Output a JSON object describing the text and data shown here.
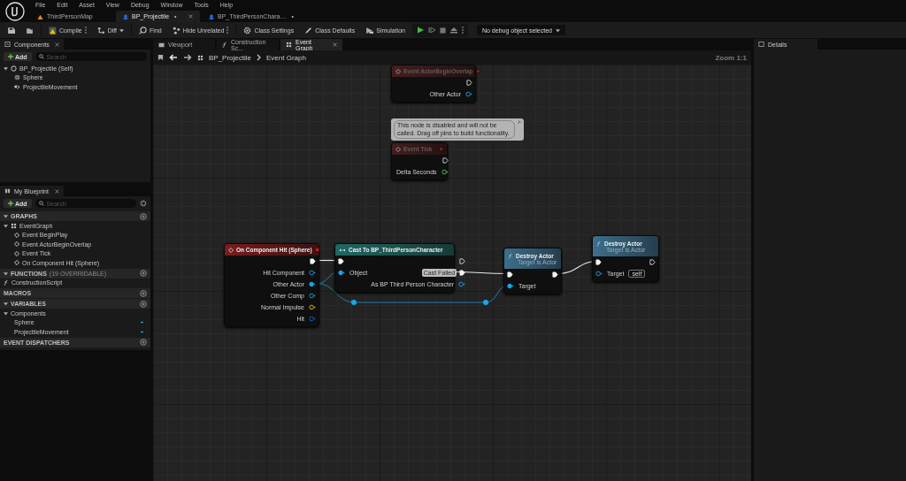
{
  "menu": [
    "File",
    "Edit",
    "Asset",
    "View",
    "Debug",
    "Window",
    "Tools",
    "Help"
  ],
  "document_tabs": [
    {
      "label": "ThirdPersonMap",
      "selected": false
    },
    {
      "label": "BP_Projectile",
      "selected": true,
      "mark": "•"
    },
    {
      "label": "BP_ThirdPersonChara…",
      "selected": false,
      "mark": "•"
    }
  ],
  "toolbar": [
    {
      "kind": "icon"
    },
    {
      "kind": "icon"
    },
    {
      "kind": "menu",
      "label": "Compile"
    },
    {
      "kind": "dropdown",
      "label": "Diff"
    },
    {
      "kind": "button",
      "label": "Find"
    },
    {
      "kind": "menu",
      "label": "Hide Unrelated"
    },
    {
      "kind": "button",
      "label": "Class Settings"
    },
    {
      "kind": "button",
      "label": "Class Defaults"
    },
    {
      "kind": "button",
      "label": "Simulation"
    }
  ],
  "debug_filter": {
    "value": "No debug object selected"
  },
  "components_panel": {
    "title": "Components",
    "add": "Add",
    "search": {
      "placeholder": "Search"
    },
    "tree": [
      {
        "label": "BP_Projectile (Self)",
        "children": [
          {
            "label": "Sphere"
          },
          {
            "label": "ProjectileMovement"
          }
        ]
      }
    ]
  },
  "blueprint_panel": {
    "title": "My Blueprint",
    "add": "Add",
    "search": {
      "placeholder": "Search"
    },
    "sections": [
      {
        "title": "GRAPHS",
        "expanded": true,
        "items": [
          {
            "label": "EventGraph",
            "children": [
              {
                "label": "Event BeginPlay"
              },
              {
                "label": "Event ActorBeginOverlap"
              },
              {
                "label": "Event Tick"
              },
              {
                "label": "On Component Hit (Sphere)"
              }
            ]
          }
        ]
      },
      {
        "title": "FUNCTIONS",
        "note": "(19 OVERRIDABLE)",
        "expanded": true,
        "items": [
          {
            "label": "ConstructionScript"
          }
        ]
      },
      {
        "title": "MACROS",
        "expanded": false
      },
      {
        "title": "VARIABLES",
        "expanded": true,
        "items": [
          {
            "label": "Components",
            "children": [
              {
                "label": "Sphere"
              },
              {
                "label": "ProjectileMovement"
              }
            ]
          }
        ]
      },
      {
        "title": "EVENT DISPATCHERS",
        "expanded": false
      }
    ]
  },
  "graph_tabs": [
    {
      "label": "Viewport",
      "selected": false
    },
    {
      "label": "Construction Sc...",
      "selected": false
    },
    {
      "label": "Event Graph",
      "selected": true
    }
  ],
  "breadcrumb": [
    "BP_Projectile",
    "Event Graph"
  ],
  "zoom": "Zoom 1:1",
  "nodes": [
    {
      "kind": "event",
      "title": "Event ActorBeginOverlap",
      "disabled": true,
      "outputs": [
        {
          "kind": "exec",
          "connected": false
        },
        {
          "kind": "object",
          "label": "Other Actor",
          "connected": false
        }
      ]
    },
    {
      "kind": "event",
      "title": "Event Tick",
      "disabled": true,
      "comment": "This node is disabled and will not be called. Drag off pins to build functionality.",
      "outputs": [
        {
          "kind": "exec",
          "connected": false
        },
        {
          "kind": "float",
          "label": "Delta Seconds",
          "connected": false
        }
      ]
    },
    {
      "kind": "event",
      "title": "On Component Hit (Sphere)",
      "disabled": false,
      "outputs": [
        {
          "kind": "exec",
          "connected": true
        },
        {
          "kind": "object",
          "label": "Hit Component",
          "connected": false
        },
        {
          "kind": "object",
          "label": "Other Actor",
          "connected": true
        },
        {
          "kind": "object",
          "label": "Other Comp",
          "connected": false
        },
        {
          "kind": "vector",
          "label": "Normal Impulse",
          "connected": false
        },
        {
          "kind": "struct",
          "label": "Hit",
          "connected": false
        }
      ]
    },
    {
      "kind": "cast",
      "title": "Cast To BP_ThirdPersonCharacter",
      "disabled": false,
      "inputs": [
        {
          "kind": "exec",
          "connected": true
        },
        {
          "kind": "object",
          "label": "Object",
          "connected": true
        }
      ],
      "outputs": [
        {
          "kind": "exec",
          "connected": false
        },
        {
          "kind": "exec",
          "label": "Cast Failed",
          "connected": true,
          "hovered": true
        },
        {
          "kind": "object",
          "label": "As BP Third Person Character",
          "connected": false
        }
      ]
    },
    {
      "kind": "function",
      "title": "Destroy Actor",
      "subtitle": "Target is Actor",
      "disabled": false,
      "inputs": [
        {
          "kind": "exec",
          "connected": true
        },
        {
          "kind": "object",
          "label": "Target",
          "connected": true
        }
      ],
      "outputs": [
        {
          "kind": "exec",
          "connected": true
        }
      ]
    },
    {
      "kind": "function",
      "title": "Destroy Actor",
      "subtitle": "Target is Actor",
      "disabled": false,
      "inputs": [
        {
          "kind": "exec",
          "connected": true
        },
        {
          "kind": "object",
          "label": "Target",
          "connected": false,
          "default": "self"
        }
      ],
      "outputs": [
        {
          "kind": "exec",
          "connected": false
        }
      ]
    }
  ],
  "details_panel": {
    "title": "Details"
  }
}
